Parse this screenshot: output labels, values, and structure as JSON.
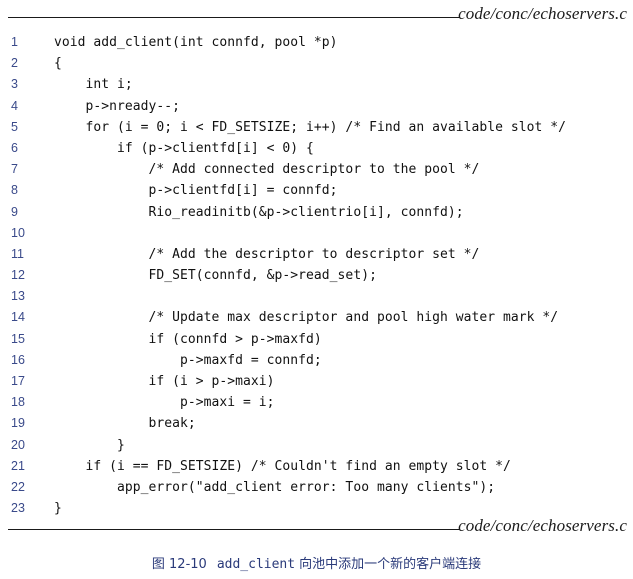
{
  "header": {
    "file_label": "code/conc/echoservers.c"
  },
  "footer": {
    "file_label": "code/conc/echoservers.c"
  },
  "code_lines": [
    {
      "num": "1",
      "text": "void add_client(int connfd, pool *p)"
    },
    {
      "num": "2",
      "text": "{"
    },
    {
      "num": "3",
      "text": "    int i;"
    },
    {
      "num": "4",
      "text": "    p->nready--;"
    },
    {
      "num": "5",
      "text": "    for (i = 0; i < FD_SETSIZE; i++) /* Find an available slot */"
    },
    {
      "num": "6",
      "text": "        if (p->clientfd[i] < 0) {"
    },
    {
      "num": "7",
      "text": "            /* Add connected descriptor to the pool */"
    },
    {
      "num": "8",
      "text": "            p->clientfd[i] = connfd;"
    },
    {
      "num": "9",
      "text": "            Rio_readinitb(&p->clientrio[i], connfd);"
    },
    {
      "num": "10",
      "text": ""
    },
    {
      "num": "11",
      "text": "            /* Add the descriptor to descriptor set */"
    },
    {
      "num": "12",
      "text": "            FD_SET(connfd, &p->read_set);"
    },
    {
      "num": "13",
      "text": ""
    },
    {
      "num": "14",
      "text": "            /* Update max descriptor and pool high water mark */"
    },
    {
      "num": "15",
      "text": "            if (connfd > p->maxfd)"
    },
    {
      "num": "16",
      "text": "                p->maxfd = connfd;"
    },
    {
      "num": "17",
      "text": "            if (i > p->maxi)"
    },
    {
      "num": "18",
      "text": "                p->maxi = i;"
    },
    {
      "num": "19",
      "text": "            break;"
    },
    {
      "num": "20",
      "text": "        }"
    },
    {
      "num": "21",
      "text": "    if (i == FD_SETSIZE) /* Couldn't find an empty slot */"
    },
    {
      "num": "22",
      "text": "        app_error(\"add_client error: Too many clients\");"
    },
    {
      "num": "23",
      "text": "}"
    }
  ],
  "caption": {
    "figure": "图 12-10",
    "function_name": "add_client",
    "description": "向池中添加一个新的客户端连接"
  }
}
